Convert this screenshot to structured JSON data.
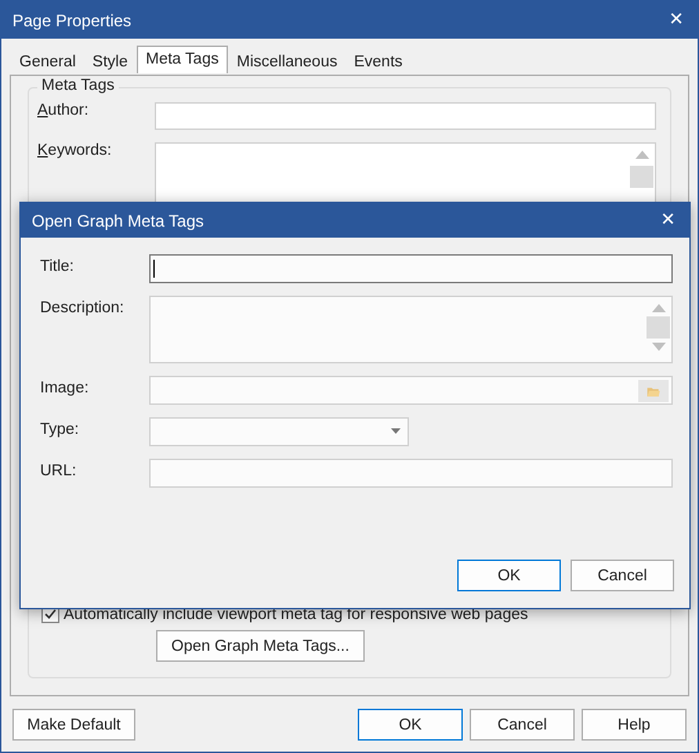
{
  "window": {
    "title": "Page Properties",
    "close": "✕"
  },
  "tabs": [
    {
      "label": "General",
      "selected": false
    },
    {
      "label": "Style",
      "selected": false
    },
    {
      "label": "Meta Tags",
      "selected": true
    },
    {
      "label": "Miscellaneous",
      "selected": false
    },
    {
      "label": "Events",
      "selected": false
    }
  ],
  "group": {
    "title": "Meta Tags",
    "fields": [
      {
        "label": "Author:",
        "kind": "text"
      },
      {
        "label": "Keywords:",
        "kind": "textarea"
      }
    ],
    "checkbox": {
      "label": "Automatically include viewport meta tag for responsive web pages",
      "checked": true
    },
    "button": "Open Graph Meta Tags..."
  },
  "buttons": [
    {
      "label": "Make Default",
      "default": false
    },
    {
      "label": "OK",
      "default": true
    },
    {
      "label": "Cancel",
      "default": false
    },
    {
      "label": "Help",
      "default": false
    }
  ],
  "dialog": {
    "title": "Open Graph Meta Tags",
    "close": "✕",
    "fields": [
      {
        "label": "Title:",
        "kind": "text",
        "focused": true
      },
      {
        "label": "Description:",
        "kind": "textarea",
        "focused": false
      },
      {
        "label": "Image:",
        "kind": "file",
        "focused": false
      },
      {
        "label": "Type:",
        "kind": "select",
        "focused": false
      },
      {
        "label": "URL:",
        "kind": "text",
        "focused": false
      }
    ],
    "buttons": [
      {
        "label": "OK",
        "default": true
      },
      {
        "label": "Cancel",
        "default": false
      }
    ]
  }
}
